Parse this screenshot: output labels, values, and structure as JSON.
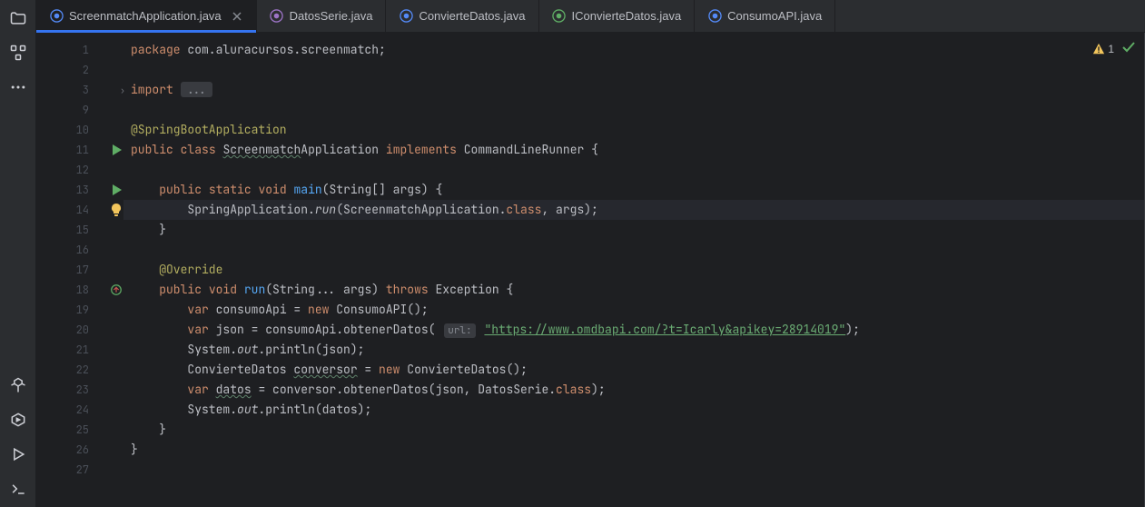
{
  "tabs": [
    {
      "label": "ScreenmatchApplication.java",
      "active": true,
      "closable": true,
      "iconColor": "#548af7"
    },
    {
      "label": "DatosSerie.java",
      "active": false,
      "closable": false,
      "iconColor": "#9d74c7"
    },
    {
      "label": "ConvierteDatos.java",
      "active": false,
      "closable": false,
      "iconColor": "#548af7"
    },
    {
      "label": "IConvierteDatos.java",
      "active": false,
      "closable": false,
      "iconColor": "#5fad65"
    },
    {
      "label": "ConsumoAPI.java",
      "active": false,
      "closable": false,
      "iconColor": "#548af7"
    }
  ],
  "status": {
    "warnings": "1"
  },
  "lines": {
    "l1": {
      "num": "1"
    },
    "l2": {
      "num": "2"
    },
    "l3": {
      "num": "3"
    },
    "l9": {
      "num": "9"
    },
    "l10": {
      "num": "10"
    },
    "l11": {
      "num": "11"
    },
    "l12": {
      "num": "12"
    },
    "l13": {
      "num": "13"
    },
    "l14": {
      "num": "14"
    },
    "l15": {
      "num": "15"
    },
    "l16": {
      "num": "16"
    },
    "l17": {
      "num": "17"
    },
    "l18": {
      "num": "18"
    },
    "l19": {
      "num": "19"
    },
    "l20": {
      "num": "20"
    },
    "l21": {
      "num": "21"
    },
    "l22": {
      "num": "22"
    },
    "l23": {
      "num": "23"
    },
    "l24": {
      "num": "24"
    },
    "l25": {
      "num": "25"
    },
    "l26": {
      "num": "26"
    },
    "l27": {
      "num": "27"
    }
  },
  "code": {
    "kw_package": "package",
    "pkg_name": " com.aluracursos.screenmatch",
    "kw_import": "import",
    "fold_dots": "...",
    "ann_springboot": "@SpringBootApplication",
    "kw_public": "public",
    "kw_class": "class",
    "kw_static": "static",
    "kw_void": "void",
    "kw_new": "new",
    "kw_var": "var",
    "kw_throws": "throws",
    "kw_implements": "implements",
    "cls_screenmatch": "Screenmatch",
    "cls_application": "Application",
    "cls_cmdrunner": "CommandLineRunner",
    "fn_main": "main",
    "main_params": "(String[] args) {",
    "spring_app": "SpringApplication.",
    "fn_run_i": "run",
    "run_args1": "(ScreenmatchApplication.",
    "kw_class_lit": "class",
    "run_args2": ", args)",
    "brace_close": "}",
    "brace_open_end": " {",
    "ann_override": "@Override",
    "fn_run": "run",
    "run_params": "(String... args)",
    "cls_exception": "Exception",
    "var_consumoapi": " consumoApi =",
    "cls_consumoapi": "ConsumoAPI",
    "parens_empty": "()",
    "var_json": " json = consumoApi.obtenerDatos(",
    "hint_url": "url:",
    "url_str": "\"https://www.omdbapi.com/?t=Icarly&apikey=28914019\"",
    "paren_close": ")",
    "sysout": "System.",
    "out_i": "out",
    "println": ".println(json)",
    "cls_conviertedatos": "ConvierteDatos",
    "var_conversor": "conversor",
    "eq": " =",
    "var_datos": "datos",
    "obtenerdatos": " = conversor.obtenerDatos(json, DatosSerie.",
    "println_datos": ".println(datos)",
    "semi": ";",
    "space4": "    ",
    "space8": "        "
  }
}
